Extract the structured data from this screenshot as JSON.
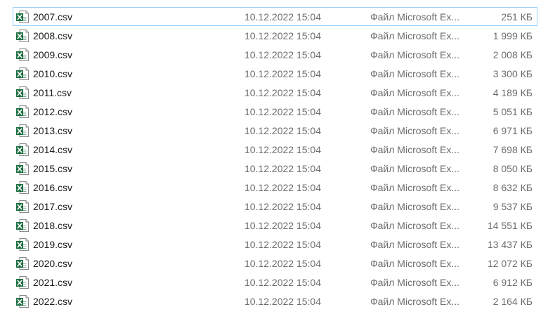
{
  "file_list": {
    "files": [
      {
        "name": "2007.csv",
        "modified": "10.12.2022 15:04",
        "type": "Файл Microsoft Ex...",
        "size": "251 КБ",
        "icon": "excel-csv-icon"
      },
      {
        "name": "2008.csv",
        "modified": "10.12.2022 15:04",
        "type": "Файл Microsoft Ex...",
        "size": "1 999 КБ",
        "icon": "excel-csv-icon"
      },
      {
        "name": "2009.csv",
        "modified": "10.12.2022 15:04",
        "type": "Файл Microsoft Ex...",
        "size": "2 008 КБ",
        "icon": "excel-csv-icon"
      },
      {
        "name": "2010.csv",
        "modified": "10.12.2022 15:04",
        "type": "Файл Microsoft Ex...",
        "size": "3 300 КБ",
        "icon": "excel-csv-icon"
      },
      {
        "name": "2011.csv",
        "modified": "10.12.2022 15:04",
        "type": "Файл Microsoft Ex...",
        "size": "4 189 КБ",
        "icon": "excel-csv-icon"
      },
      {
        "name": "2012.csv",
        "modified": "10.12.2022 15:04",
        "type": "Файл Microsoft Ex...",
        "size": "5 051 КБ",
        "icon": "excel-csv-icon"
      },
      {
        "name": "2013.csv",
        "modified": "10.12.2022 15:04",
        "type": "Файл Microsoft Ex...",
        "size": "6 971 КБ",
        "icon": "excel-csv-icon"
      },
      {
        "name": "2014.csv",
        "modified": "10.12.2022 15:04",
        "type": "Файл Microsoft Ex...",
        "size": "7 698 КБ",
        "icon": "excel-csv-icon"
      },
      {
        "name": "2015.csv",
        "modified": "10.12.2022 15:04",
        "type": "Файл Microsoft Ex...",
        "size": "8 050 КБ",
        "icon": "excel-csv-icon"
      },
      {
        "name": "2016.csv",
        "modified": "10.12.2022 15:04",
        "type": "Файл Microsoft Ex...",
        "size": "8 632 КБ",
        "icon": "excel-csv-icon"
      },
      {
        "name": "2017.csv",
        "modified": "10.12.2022 15:04",
        "type": "Файл Microsoft Ex...",
        "size": "9 537 КБ",
        "icon": "excel-csv-icon"
      },
      {
        "name": "2018.csv",
        "modified": "10.12.2022 15:04",
        "type": "Файл Microsoft Ex...",
        "size": "14 551 КБ",
        "icon": "excel-csv-icon"
      },
      {
        "name": "2019.csv",
        "modified": "10.12.2022 15:04",
        "type": "Файл Microsoft Ex...",
        "size": "13 437 КБ",
        "icon": "excel-csv-icon"
      },
      {
        "name": "2020.csv",
        "modified": "10.12.2022 15:04",
        "type": "Файл Microsoft Ex...",
        "size": "12 072 КБ",
        "icon": "excel-csv-icon"
      },
      {
        "name": "2021.csv",
        "modified": "10.12.2022 15:04",
        "type": "Файл Microsoft Ex...",
        "size": "6 912 КБ",
        "icon": "excel-csv-icon"
      },
      {
        "name": "2022.csv",
        "modified": "10.12.2022 15:04",
        "type": "Файл Microsoft Ex...",
        "size": "2 164 КБ",
        "icon": "excel-csv-icon"
      }
    ]
  },
  "colors": {
    "focus_border": "#99d1ff",
    "excel_green": "#1d6f42",
    "secondary_text": "#6d6d6d"
  }
}
